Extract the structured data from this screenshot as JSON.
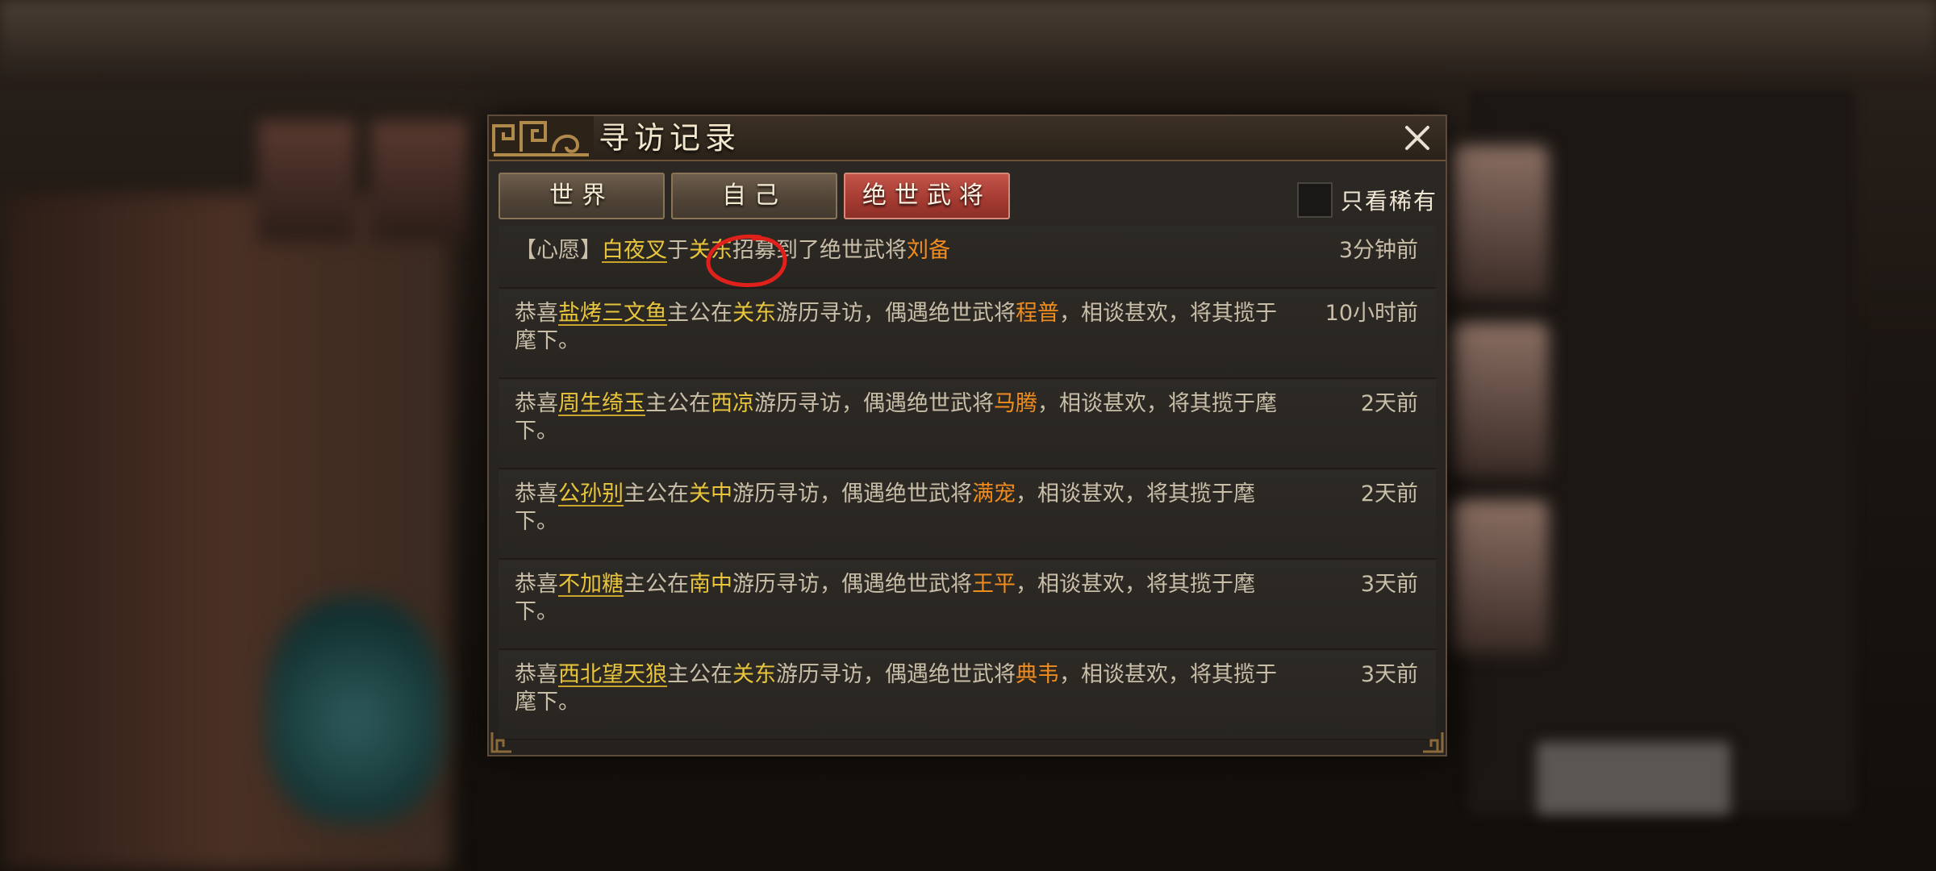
{
  "dialog": {
    "title": "寻访记录",
    "tabs": [
      {
        "label": "世界",
        "active": false
      },
      {
        "label": "自己",
        "active": false
      },
      {
        "label": "绝世武将",
        "active": true
      }
    ],
    "filter_label": "只看稀有",
    "filter_checked": false
  },
  "records": [
    {
      "segments": [
        {
          "t": "【心愿】",
          "s": "n"
        },
        {
          "t": "白夜叉",
          "s": "p"
        },
        {
          "t": "于",
          "s": "n"
        },
        {
          "t": "关东",
          "s": "c"
        },
        {
          "t": "招募到了绝世武将",
          "s": "n"
        },
        {
          "t": "刘备",
          "s": "g"
        }
      ],
      "time": "3分钟前"
    },
    {
      "segments": [
        {
          "t": "恭喜",
          "s": "n"
        },
        {
          "t": "盐烤三文鱼",
          "s": "p"
        },
        {
          "t": "主公在",
          "s": "n"
        },
        {
          "t": "关东",
          "s": "c"
        },
        {
          "t": "游历寻访，偶遇绝世武将",
          "s": "n"
        },
        {
          "t": "程普",
          "s": "g"
        },
        {
          "t": "，相谈甚欢，将其揽于麾下。",
          "s": "n"
        }
      ],
      "time": "10小时前"
    },
    {
      "segments": [
        {
          "t": "恭喜",
          "s": "n"
        },
        {
          "t": "周生绮玉",
          "s": "p"
        },
        {
          "t": "主公在",
          "s": "n"
        },
        {
          "t": "西凉",
          "s": "c"
        },
        {
          "t": "游历寻访，偶遇绝世武将",
          "s": "n"
        },
        {
          "t": "马腾",
          "s": "g"
        },
        {
          "t": "，相谈甚欢，将其揽于麾下。",
          "s": "n"
        }
      ],
      "time": "2天前"
    },
    {
      "segments": [
        {
          "t": "恭喜",
          "s": "n"
        },
        {
          "t": "公孙别",
          "s": "p"
        },
        {
          "t": "主公在",
          "s": "n"
        },
        {
          "t": "关中",
          "s": "c"
        },
        {
          "t": "游历寻访，偶遇绝世武将",
          "s": "n"
        },
        {
          "t": "满宠",
          "s": "g"
        },
        {
          "t": "，相谈甚欢，将其揽于麾下。",
          "s": "n"
        }
      ],
      "time": "2天前"
    },
    {
      "segments": [
        {
          "t": "恭喜",
          "s": "n"
        },
        {
          "t": "不加糖",
          "s": "p"
        },
        {
          "t": "主公在",
          "s": "n"
        },
        {
          "t": "南中",
          "s": "c"
        },
        {
          "t": "游历寻访，偶遇绝世武将",
          "s": "n"
        },
        {
          "t": "王平",
          "s": "g"
        },
        {
          "t": "，相谈甚欢，将其揽于麾下。",
          "s": "n"
        }
      ],
      "time": "3天前"
    },
    {
      "segments": [
        {
          "t": "恭喜",
          "s": "n"
        },
        {
          "t": "西北望天狼",
          "s": "p"
        },
        {
          "t": "主公在",
          "s": "n"
        },
        {
          "t": "关东",
          "s": "c"
        },
        {
          "t": "游历寻访，偶遇绝世武将",
          "s": "n"
        },
        {
          "t": "典韦",
          "s": "g"
        },
        {
          "t": "，相谈甚欢，将其揽于麾下。",
          "s": "n"
        }
      ],
      "time": "3天前"
    }
  ],
  "colors": {
    "text": "#c9bea8",
    "player_name": "#e8c53a",
    "place": "#e8c53a",
    "general": "#f08c1e",
    "active_tab": "#a33a31",
    "annotation": "#e0201a"
  },
  "icons": {
    "close": "close-icon",
    "title_ornament": "cloud-ornament-icon"
  }
}
